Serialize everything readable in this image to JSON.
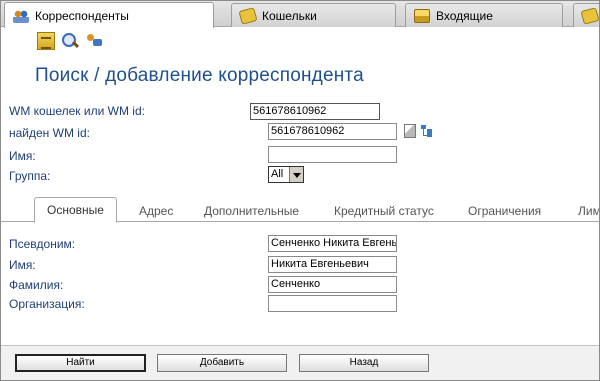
{
  "top_tabs": [
    {
      "label": "Корреспонденты",
      "icon": "people-icon"
    },
    {
      "label": "Кошельки",
      "icon": "wallet-icon"
    },
    {
      "label": "Входящие",
      "icon": "inbox-icon"
    }
  ],
  "toolbar": {
    "icons": [
      "documents-icon",
      "search-icon",
      "add-correspondent-icon"
    ]
  },
  "page_title": "Поиск / добавление корреспондента",
  "search_form": {
    "wm_label": "WM кошелек или WM id:",
    "wm_value": "561678610962",
    "found_label": "найден WM id:",
    "found_value": "561678610962",
    "name_label": "Имя:",
    "name_value": "",
    "group_label": "Группа:",
    "group_value": "All"
  },
  "inner_tabs": [
    "Основные",
    "Адрес",
    "Дополнительные",
    "Кредитный статус",
    "Ограничения",
    "Лими"
  ],
  "details": {
    "pseudonym_label": "Псевдоним:",
    "pseudonym_value": "Сенченко Никита Евгень",
    "name_label": "Имя:",
    "name_value": "Никита Евгеньевич",
    "surname_label": "Фамилия:",
    "surname_value": "Сенченко",
    "org_label": "Организация:",
    "org_value": ""
  },
  "buttons": {
    "find": "Найти",
    "add": "Добавить",
    "back": "Назад"
  },
  "colors": {
    "title": "#1f4f8f",
    "label": "#1f3f75",
    "footer_bg": "#f1f1f1"
  }
}
